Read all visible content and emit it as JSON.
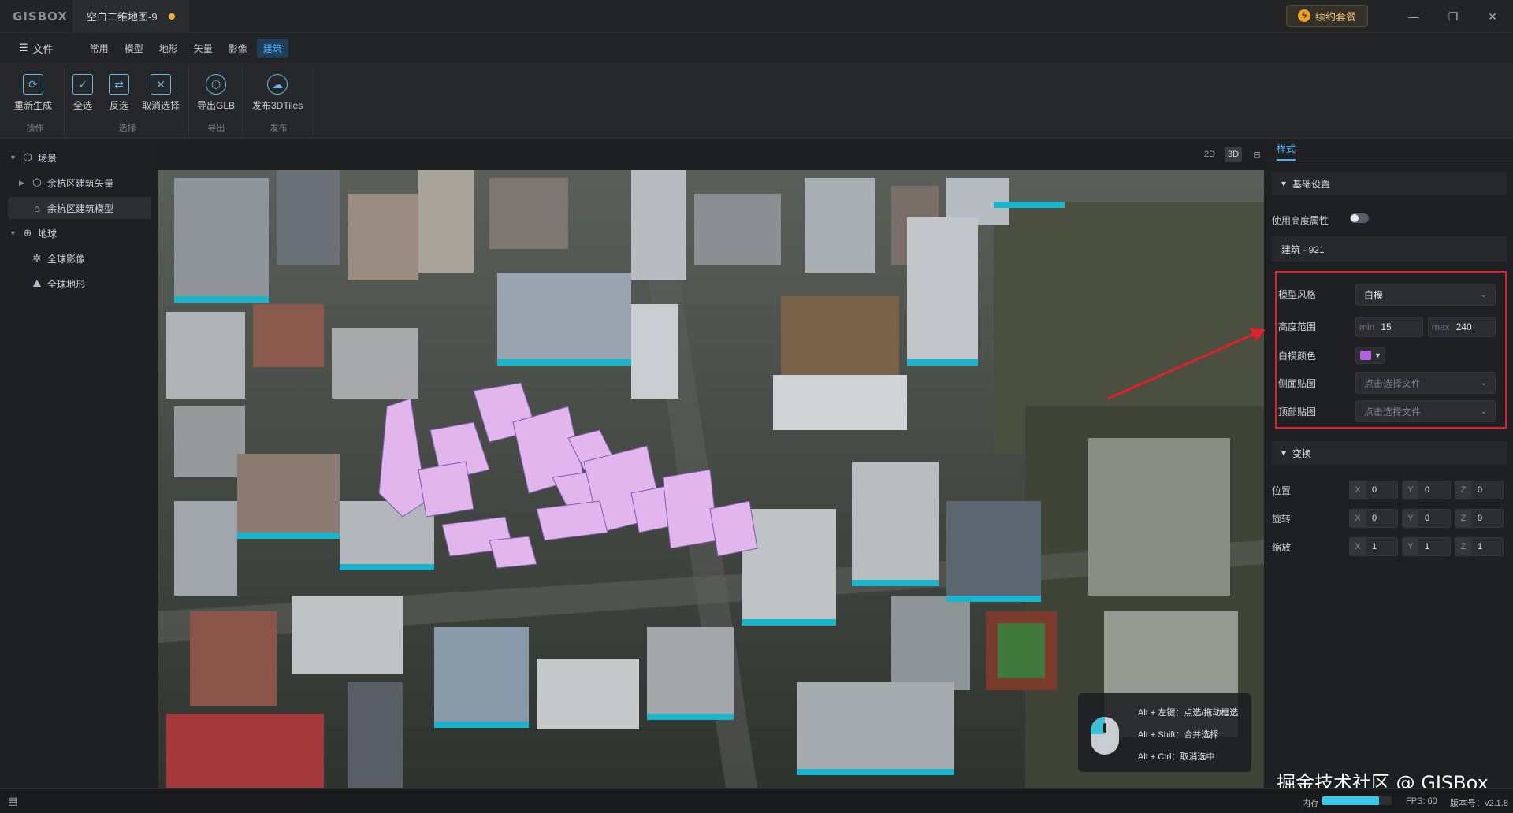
{
  "app": {
    "logo": "GISBOX",
    "doc_tab": "空白二维地图-9",
    "renew_label": "续约套餐"
  },
  "window_controls": {
    "minimize": "—",
    "restore": "❐",
    "close": "✕"
  },
  "menu": {
    "file": "文件",
    "items": [
      "常用",
      "模型",
      "地形",
      "矢量",
      "影像",
      "建筑"
    ],
    "active": "建筑"
  },
  "ribbon": {
    "groups": [
      {
        "caption": "操作",
        "buttons": [
          {
            "label": "重新生成",
            "icon": "regenerate-icon"
          }
        ]
      },
      {
        "caption": "选择",
        "buttons": [
          {
            "label": "全选",
            "icon": "select-all-icon"
          },
          {
            "label": "反选",
            "icon": "invert-select-icon"
          },
          {
            "label": "取消选择",
            "icon": "deselect-icon"
          }
        ]
      },
      {
        "caption": "导出",
        "buttons": [
          {
            "label": "导出GLB",
            "icon": "export-glb-icon"
          }
        ]
      },
      {
        "caption": "发布",
        "buttons": [
          {
            "label": "发布3DTiles",
            "icon": "publish-cloud-icon"
          }
        ]
      }
    ]
  },
  "tree": {
    "scene": "场景",
    "scene_items": [
      "余杭区建筑矢量",
      "余杭区建筑模型"
    ],
    "globe": "地球",
    "globe_items": [
      "全球影像",
      "全球地形"
    ]
  },
  "view_modes": [
    "2D",
    "3D",
    "⊟"
  ],
  "active_view_mode": "3D",
  "hint": {
    "lines": [
      "Alt + 左键：点选/拖动框选",
      "Alt + Shift：合并选择",
      "Alt + Ctrl：取消选中"
    ]
  },
  "panel": {
    "tab": "样式",
    "basic_section": "基础设置",
    "use_height_label": "使用高度属性",
    "use_height_on": false,
    "building_info": "建筑 - 921",
    "model_style_label": "模型风格",
    "model_style_value": "白模",
    "height_range_label": "高度范围",
    "height_min_prefix": "min",
    "height_min": "15",
    "height_max_prefix": "max",
    "height_max": "240",
    "white_color_label": "白模颜色",
    "white_color": "#b060e0",
    "side_texture_label": "侧面贴图",
    "side_texture_placeholder": "点击选择文件",
    "top_texture_label": "顶部贴图",
    "top_texture_placeholder": "点击选择文件",
    "transform_section": "变换",
    "position_label": "位置",
    "rotation_label": "旋转",
    "scale_label": "缩放",
    "position": [
      "0",
      "0",
      "0"
    ],
    "rotation": [
      "0",
      "0",
      "0"
    ],
    "scale": [
      "1",
      "1",
      "1"
    ],
    "axes": [
      "X",
      "Y",
      "Z"
    ]
  },
  "watermark": "掘金技术社区 @ GISBox",
  "status": {
    "memory_label": "内存",
    "memory_fraction": 0.82,
    "fps": "FPS: 60",
    "version": "版本号：v2.1.8"
  },
  "colors": {
    "accent": "#4fb0ff",
    "highlight_box": "#e0202a",
    "building_base": "#1ab4cc",
    "selected_building": "#e2b6ec"
  }
}
